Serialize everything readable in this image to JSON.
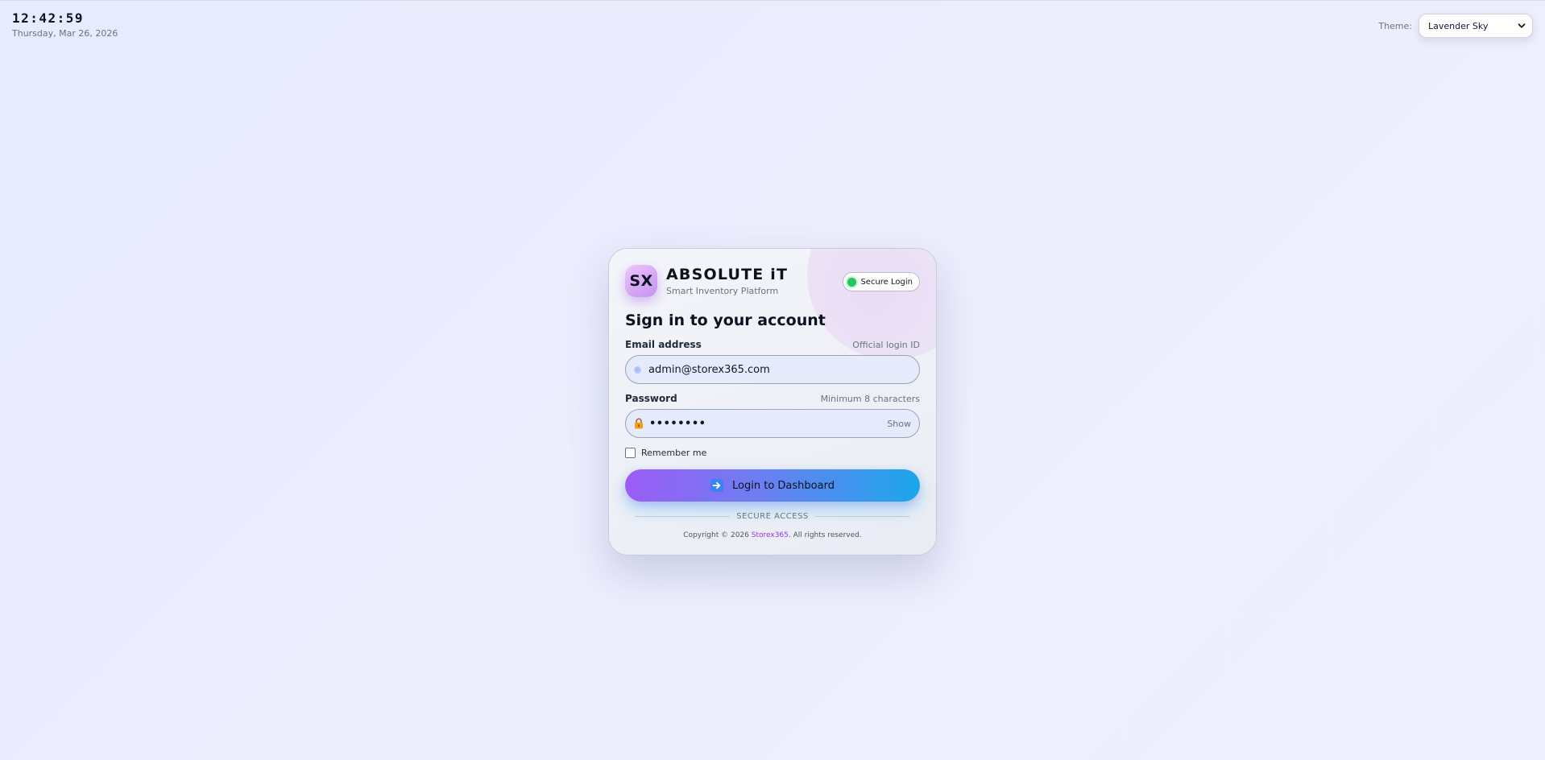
{
  "clock": {
    "time": "12:42:59",
    "date": "Thursday, Mar 26, 2026"
  },
  "theme": {
    "label": "Theme:",
    "selected": "Lavender Sky",
    "chevron_icon": "chevron-down-icon"
  },
  "brand": {
    "logo_text": "SX",
    "title": "ABSOLUTE iT",
    "subtitle": "Smart Inventory Platform"
  },
  "badge": {
    "label": "Secure Login",
    "status_color": "#22c55e"
  },
  "form": {
    "heading": "Sign in to your account",
    "email": {
      "label": "Email address",
      "hint": "Official login ID",
      "value": "admin@storex365.com",
      "icon": "email-dot-icon"
    },
    "password": {
      "label": "Password",
      "hint": "Minimum 8 characters",
      "value": "••••••••",
      "icon": "lock-icon",
      "toggle_label": "Show"
    },
    "remember_label": "Remember me",
    "submit_label": "Login to Dashboard",
    "submit_icon": "arrow-right-icon"
  },
  "footer": {
    "divider_text": "SECURE ACCESS",
    "copyright_prefix": "Copyright © 2026 ",
    "copyright_brand": "Storex365",
    "copyright_suffix": ". All rights reserved."
  },
  "colors": {
    "accent_start": "#9c5cf6",
    "accent_end": "#1ba6ea",
    "brand_link": "#9333ea"
  }
}
